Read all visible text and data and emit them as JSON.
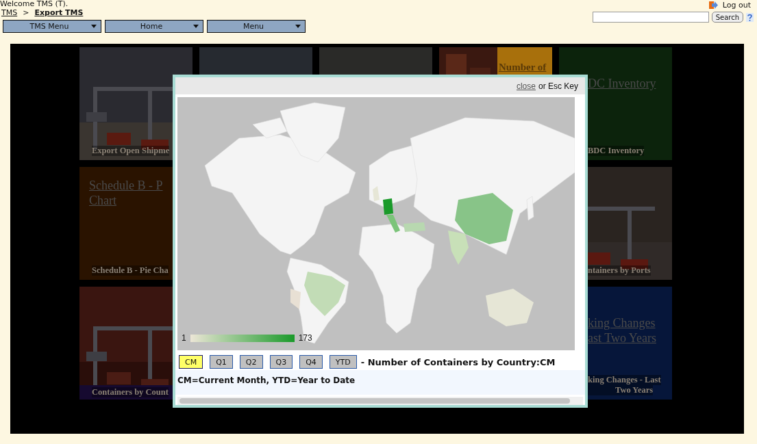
{
  "header": {
    "welcome": "Welcome TMS (T).",
    "breadcrumbs": [
      {
        "label": "TMS",
        "current": false
      },
      {
        "label": "Export TMS",
        "current": true
      }
    ],
    "separator": ">",
    "menus": [
      "TMS Menu",
      "Home",
      "Menu"
    ],
    "logout": "Log out",
    "search": {
      "button": "Search"
    }
  },
  "tile_rows": [
    {
      "tiles": [
        {
          "kind": "picture",
          "caption_lines": [
            "Export Open Shipme"
          ]
        },
        {
          "kind": "picture"
        },
        {
          "kind": "picture"
        },
        {
          "kind": "split",
          "color": "#a8700c",
          "link_lines": [
            "Number of"
          ]
        },
        {
          "kind": "panel",
          "color": "#0c230c",
          "link_lines": [
            "DC Inventory"
          ],
          "caption_lines": [
            "BDC Inventory"
          ]
        }
      ]
    },
    {
      "tiles": [
        {
          "kind": "panel",
          "color": "#2a1300",
          "link_lines": [
            "Schedule B - P",
            "Chart"
          ],
          "caption_lines": [
            "Schedule B - Pie Cha"
          ]
        },
        {
          "kind": "picture",
          "caption_lines": [
            "ntainers by Ports"
          ]
        }
      ]
    },
    {
      "tiles": [
        {
          "kind": "picture",
          "color": "#160a30",
          "caption_lines": [
            "Containers by Count"
          ]
        },
        {
          "kind": "panel",
          "color": "#06163a",
          "link_lines": [
            "king Changes",
            "ast Two Years"
          ],
          "caption_lines": [
            "king Changes - Last",
            "Two Years"
          ]
        }
      ]
    }
  ],
  "modal": {
    "close_link": "close",
    "close_hint": "or Esc Key",
    "legend": {
      "min": "1",
      "max": "173"
    },
    "periods": [
      {
        "label": "CM",
        "selected": true
      },
      {
        "label": "Q1",
        "selected": false
      },
      {
        "label": "Q2",
        "selected": false
      },
      {
        "label": "Q3",
        "selected": false
      },
      {
        "label": "Q4",
        "selected": false
      },
      {
        "label": "YTD",
        "selected": false
      }
    ],
    "title": "- Number of Containers by Country:CM",
    "note": "CM=Current Month, YTD=Year to Date"
  }
}
